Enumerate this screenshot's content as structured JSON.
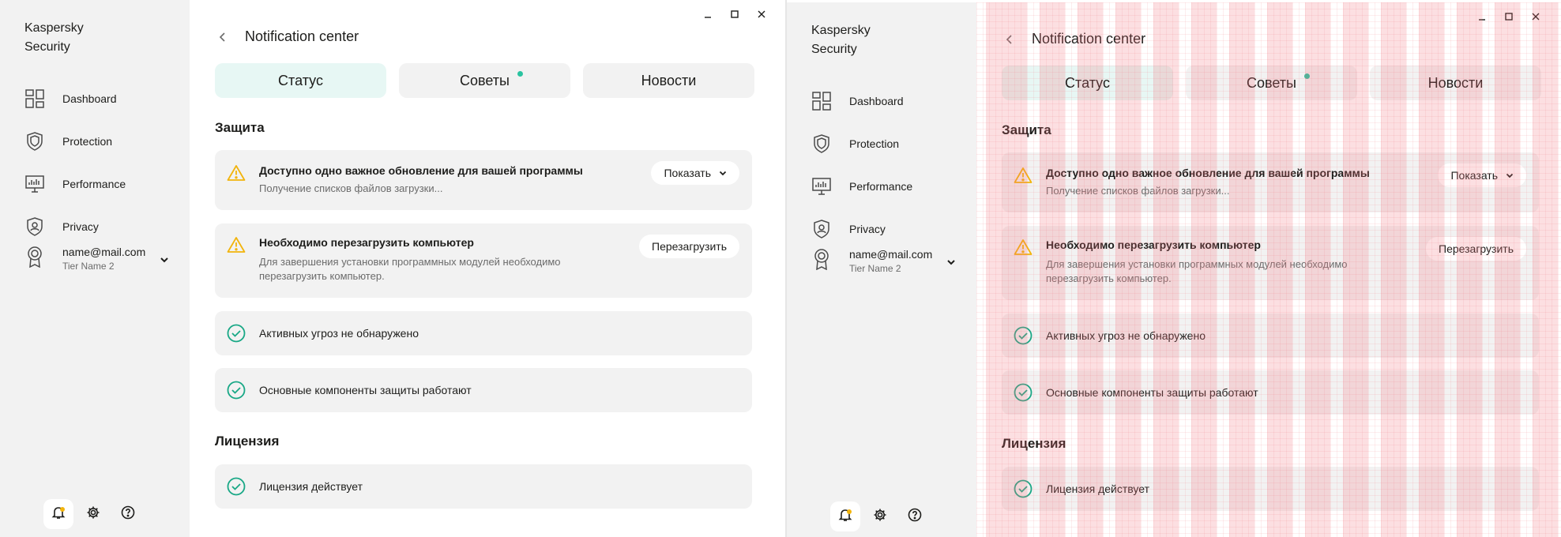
{
  "app": {
    "title": "Kaspersky Security"
  },
  "sidebar": {
    "items": [
      {
        "label": "Dashboard",
        "icon": "dashboard-icon"
      },
      {
        "label": "Protection",
        "icon": "shield-icon"
      },
      {
        "label": "Performance",
        "icon": "monitor-icon"
      },
      {
        "label": "Privacy",
        "icon": "privacy-shield-icon"
      }
    ],
    "account": {
      "email": "name@mail.com",
      "tier": "Tier Name 2",
      "icon": "award-icon"
    },
    "bottom": [
      "bell-icon",
      "gear-icon",
      "help-icon"
    ]
  },
  "header": {
    "title": "Notification center"
  },
  "tabs": [
    {
      "label": "Статус",
      "active": true,
      "dot": false
    },
    {
      "label": "Советы",
      "active": false,
      "dot": true
    },
    {
      "label": "Новости",
      "active": false,
      "dot": false
    }
  ],
  "sections": {
    "protection": "Защита",
    "license": "Лицензия"
  },
  "cards": {
    "update": {
      "title": "Доступно одно важное обновление для вашей программы",
      "desc": "Получение списков файлов загрузки...",
      "button": "Показать",
      "icon": "warning-icon"
    },
    "restart": {
      "title": "Необходимо перезагрузить компьютер",
      "desc": "Для завершения установки программных модулей необходимо перезагрузить компьютер.",
      "button": "Перезагрузить",
      "icon": "warning-icon"
    },
    "threats": {
      "title": "Активных угроз не обнаружено",
      "icon": "check-circle-icon"
    },
    "components": {
      "title": "Основные компоненты защиты работают",
      "icon": "check-circle-icon"
    },
    "license": {
      "title": "Лицензия действует",
      "icon": "check-circle-icon"
    }
  },
  "colors": {
    "accent": "#29c3a0",
    "warning": "#f2b40c",
    "check": "#19a886",
    "active_tab": "#e7f7f4"
  }
}
